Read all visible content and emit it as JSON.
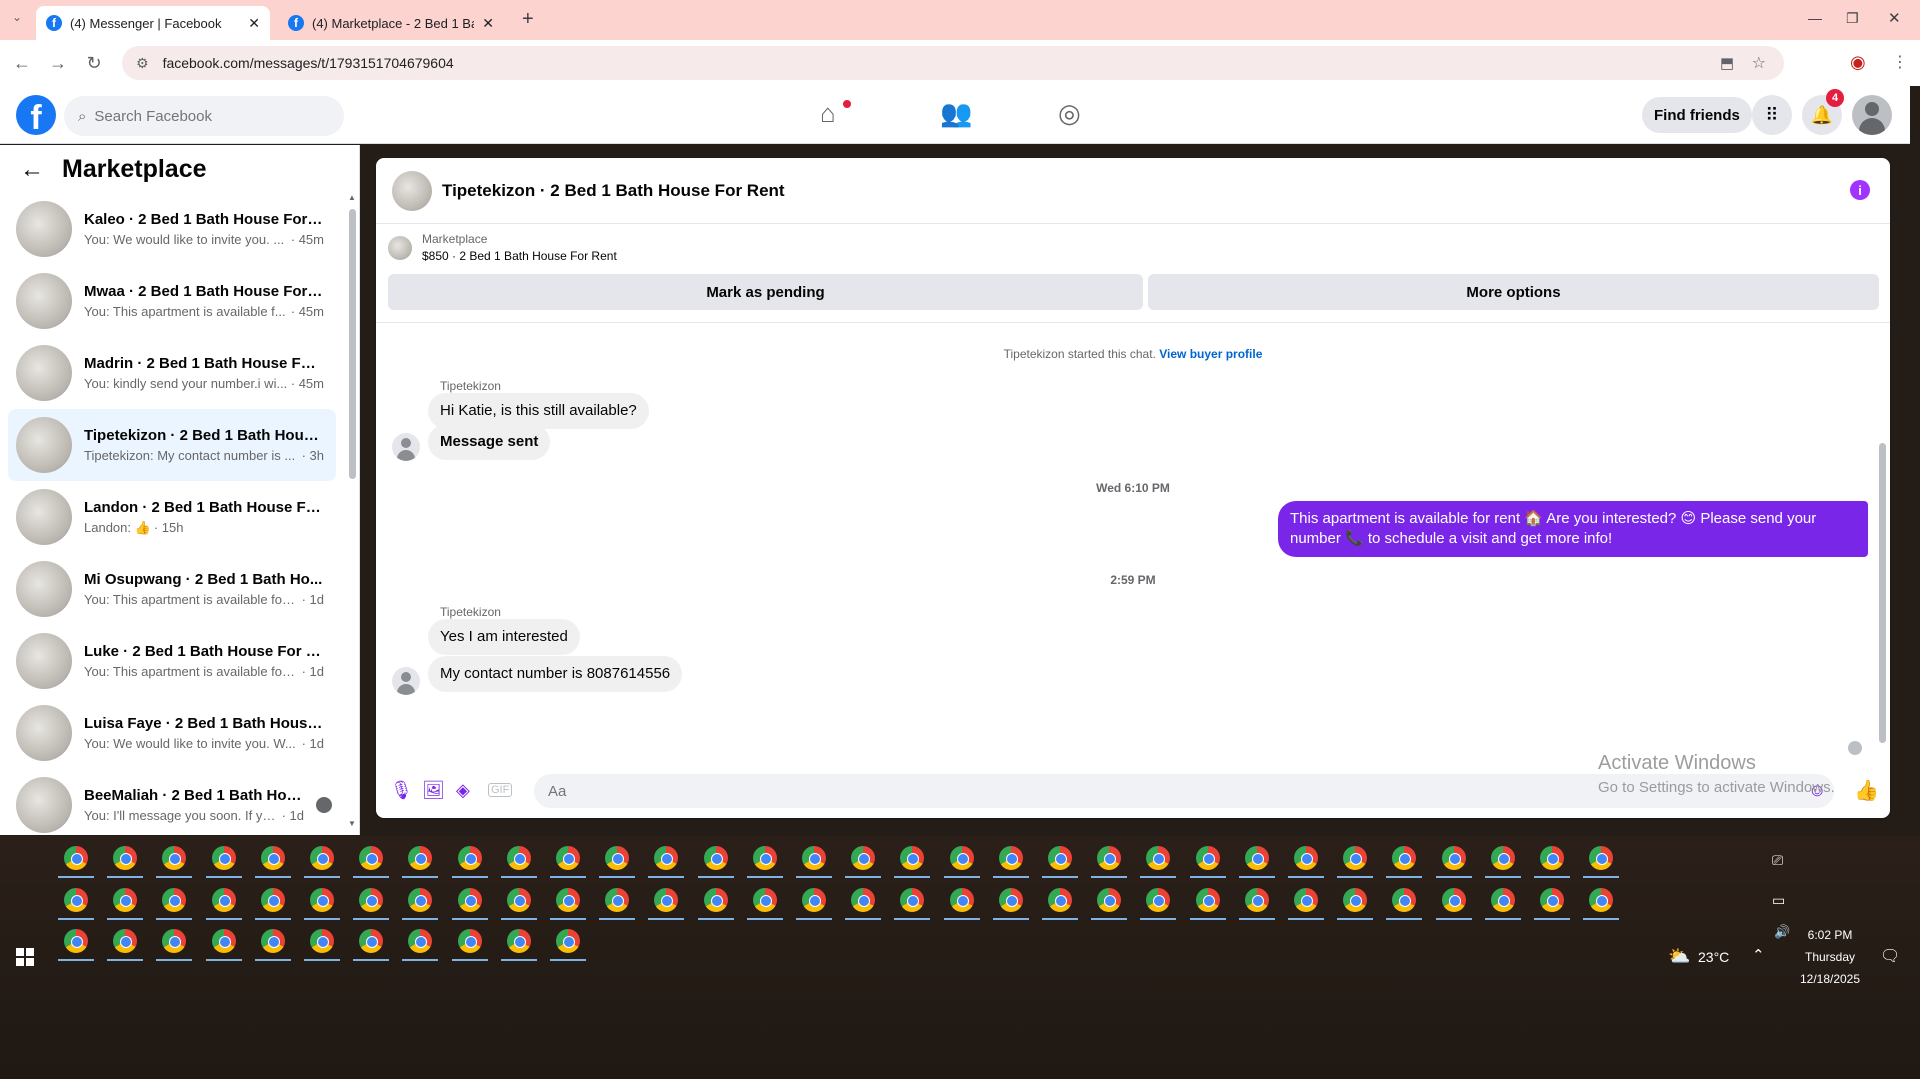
{
  "browser": {
    "tabs": [
      {
        "title": "(4) Messenger | Facebook",
        "active": true
      },
      {
        "title": "(4) Marketplace - 2 Bed 1 Bath",
        "active": false
      }
    ],
    "new_tab": "+",
    "url": "facebook.com/messages/t/1793151704679604"
  },
  "fb_header": {
    "logo": "f",
    "search_placeholder": "Search Facebook",
    "find_friends": "Find friends",
    "notification_count": "4"
  },
  "sidebar": {
    "title": "Marketplace",
    "conversations": [
      {
        "name": "Kaleo · 2 Bed 1 Bath House For R...",
        "preview": "You: We would like to invite you. ...",
        "time": "· 45m",
        "selected": false
      },
      {
        "name": "Mwaa · 2 Bed 1 Bath House For ...",
        "preview": "You: This apartment is available f...",
        "time": "· 45m",
        "selected": false
      },
      {
        "name": "Madrin · 2 Bed 1 Bath House For...",
        "preview": "You: kindly send your number.i wi...",
        "time": "· 45m",
        "selected": false
      },
      {
        "name": "Tipetekizon · 2 Bed 1 Bath Hous...",
        "preview": "Tipetekizon: My contact number is ...",
        "time": "· 3h",
        "selected": true
      },
      {
        "name": "Landon · 2 Bed 1 Bath House For...",
        "preview": "Landon: 👍",
        "time": "· 15h",
        "selected": false
      },
      {
        "name": "Mi Osupwang · 2 Bed 1 Bath Ho...",
        "preview": "You: This apartment is available for ...",
        "time": "· 1d",
        "selected": false
      },
      {
        "name": "Luke · 2 Bed 1 Bath House For R...",
        "preview": "You: This apartment is available for ...",
        "time": "· 1d",
        "selected": false
      },
      {
        "name": "Luisa Faye · 2 Bed 1 Bath House ...",
        "preview": "You: We would like to invite you. W...",
        "time": "· 1d",
        "selected": false
      },
      {
        "name": "BeeMaliah · 2 Bed 1 Bath Hou...",
        "preview": "You: I'll message you soon. If yo...",
        "time": "· 1d",
        "selected": false
      }
    ]
  },
  "chat": {
    "title": "Tipetekizon · 2 Bed 1 Bath House For Rent",
    "marketplace_label": "Marketplace",
    "listing": "$850 · 2 Bed 1 Bath House For Rent",
    "mark_pending": "Mark as pending",
    "more_options": "More options",
    "started_text": "Tipetekizon started this chat.",
    "view_profile": "View buyer profile",
    "sender_name": "Tipetekizon",
    "messages": [
      {
        "text": "Hi Katie, is this still available?",
        "direction": "in"
      },
      {
        "text": "Message sent",
        "direction": "in"
      },
      {
        "text": "This apartment is available for rent 🏠 Are you interested? 😊 Please send your number 📞 to schedule a visit and get more info!",
        "direction": "out"
      },
      {
        "text": "Yes I am interested",
        "direction": "in"
      },
      {
        "text": "My contact number is 8087614556",
        "direction": "in"
      }
    ],
    "timestamps": [
      "Wed 6:10 PM",
      "2:59 PM"
    ],
    "composer_placeholder": "Aa",
    "accent_color": "#7a26e8"
  },
  "watermark": {
    "line1": "Activate Windows",
    "line2": "Go to Settings to activate Windows."
  },
  "taskbar": {
    "weather": "23°C",
    "time": "6:02 PM",
    "day": "Thursday",
    "date": "12/18/2025"
  }
}
